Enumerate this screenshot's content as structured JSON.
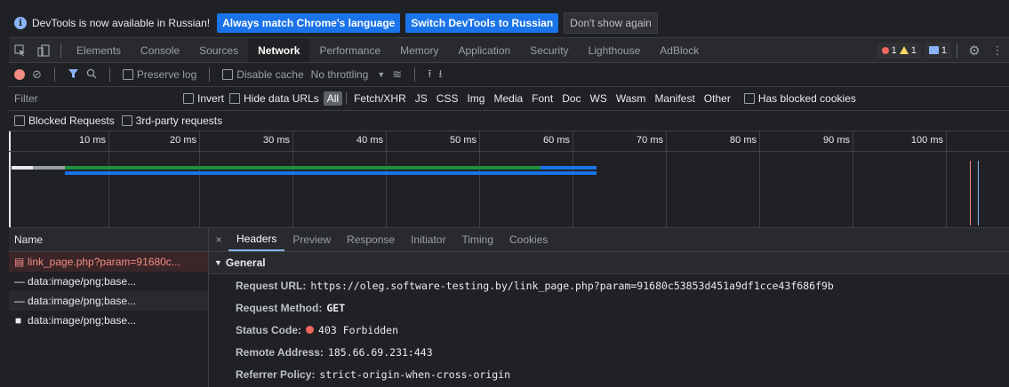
{
  "infobar": {
    "message": "DevTools is now available in Russian!",
    "btn_match": "Always match Chrome's language",
    "btn_switch": "Switch DevTools to Russian",
    "btn_dismiss": "Don't show again"
  },
  "tabs": [
    "Elements",
    "Console",
    "Sources",
    "Network",
    "Performance",
    "Memory",
    "Application",
    "Security",
    "Lighthouse",
    "AdBlock"
  ],
  "active_tab": "Network",
  "status_counts": {
    "errors": "1",
    "warnings": "1",
    "messages": "1"
  },
  "toolbar": {
    "preserve_log": "Preserve log",
    "disable_cache": "Disable cache",
    "throttling": "No throttling"
  },
  "filter": {
    "placeholder": "Filter",
    "invert": "Invert",
    "hide_data_urls": "Hide data URLs",
    "types": [
      "All",
      "Fetch/XHR",
      "JS",
      "CSS",
      "Img",
      "Media",
      "Font",
      "Doc",
      "WS",
      "Wasm",
      "Manifest",
      "Other"
    ],
    "has_blocked_cookies": "Has blocked cookies",
    "blocked_requests": "Blocked Requests",
    "third_party": "3rd-party requests"
  },
  "timeline": {
    "ticks": [
      "10 ms",
      "20 ms",
      "30 ms",
      "40 ms",
      "50 ms",
      "60 ms",
      "70 ms",
      "80 ms",
      "90 ms",
      "100 ms"
    ]
  },
  "request_list": {
    "header": "Name",
    "rows": [
      {
        "name": "link_page.php?param=91680c...",
        "icon": "document-icon"
      },
      {
        "name": "data:image/png;base...",
        "icon": "dash-icon"
      },
      {
        "name": "data:image/png;base...",
        "icon": "dash-icon"
      },
      {
        "name": "data:image/png;base...",
        "icon": "square-icon"
      }
    ]
  },
  "details": {
    "tabs": [
      "Headers",
      "Preview",
      "Response",
      "Initiator",
      "Timing",
      "Cookies"
    ],
    "section": "General",
    "request_url_label": "Request URL:",
    "request_url": "https://oleg.software-testing.by/link_page.php?param=91680c53853d451a9df1cce43f686f9b",
    "method_label": "Request Method:",
    "method": "GET",
    "status_label": "Status Code:",
    "status": "403 Forbidden",
    "remote_label": "Remote Address:",
    "remote": "185.66.69.231:443",
    "referrer_label": "Referrer Policy:",
    "referrer": "strict-origin-when-cross-origin"
  }
}
